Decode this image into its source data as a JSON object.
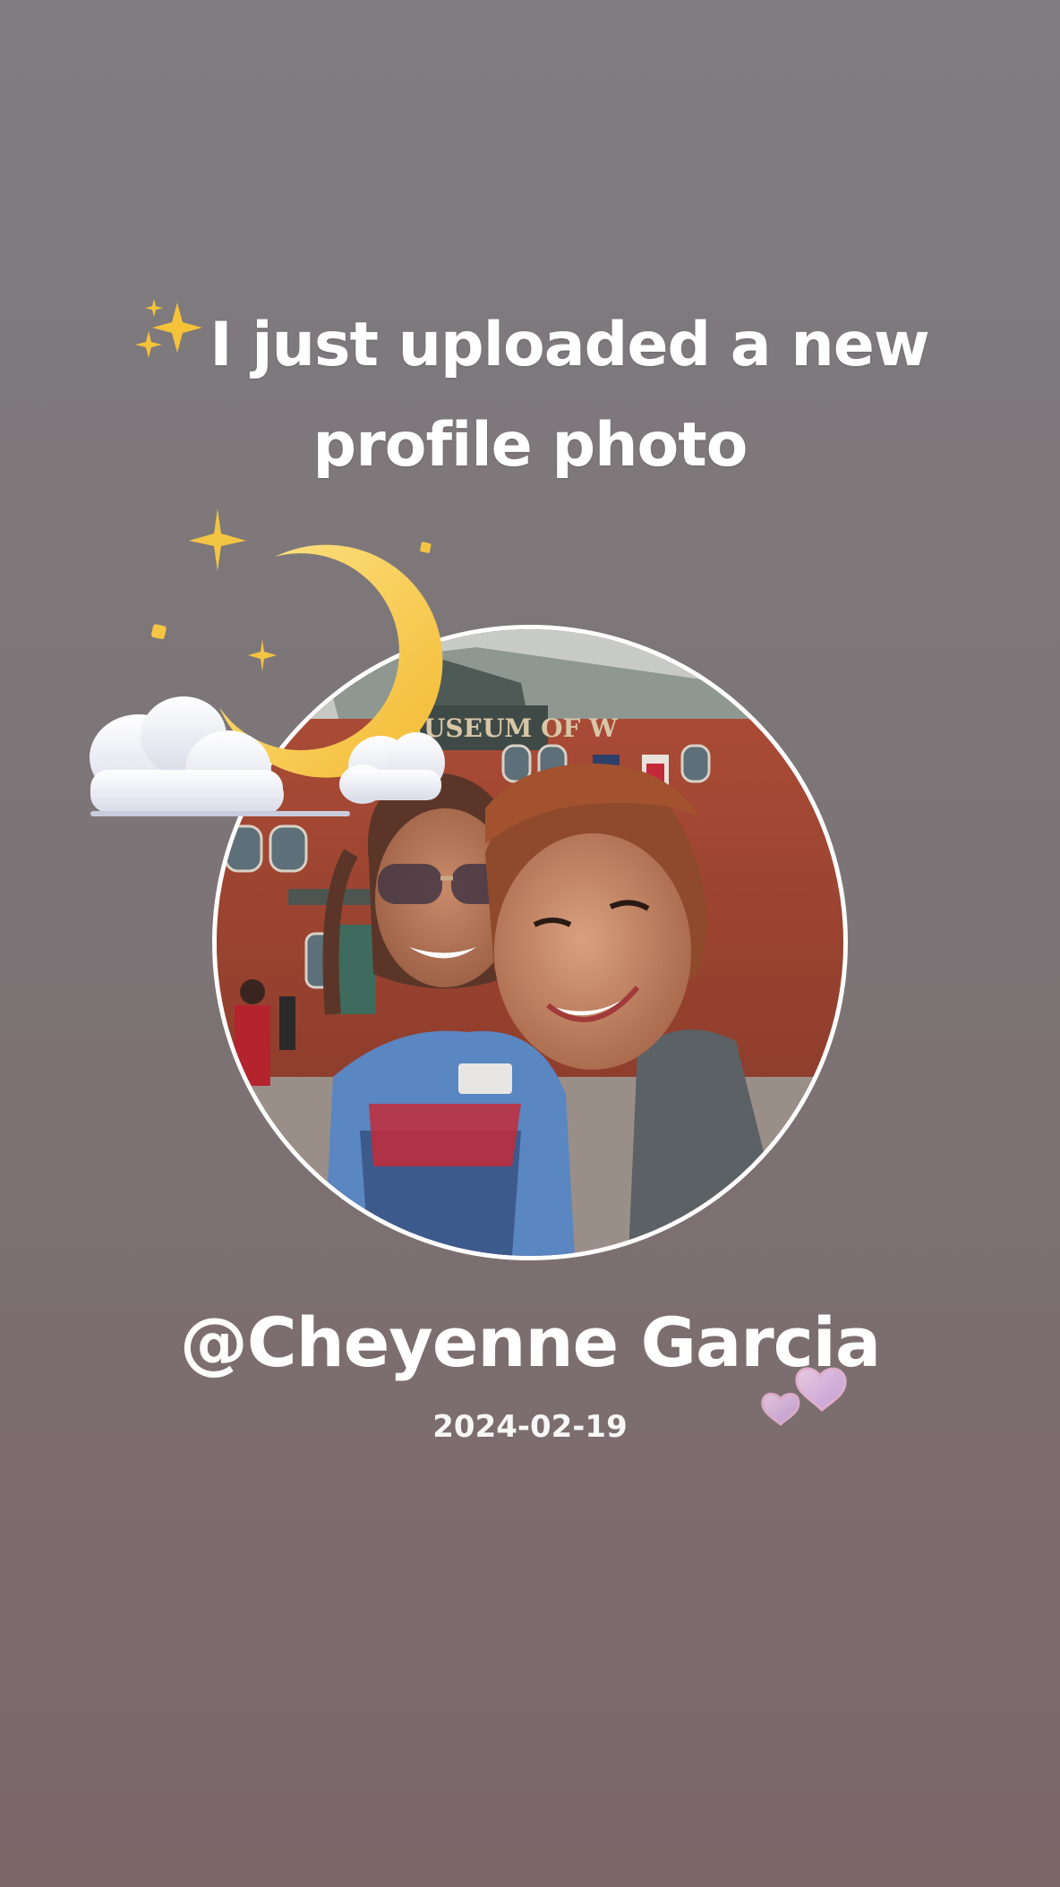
{
  "story": {
    "headline": "I just uploaded a new profile photo",
    "username": "@Cheyenne Garcia",
    "date": "2024-02-19",
    "sign_text": "MUSEUM OF W"
  },
  "icons": {
    "headline_icon": "sparkles-icon",
    "decor_top": "moon-clouds-stars-icon",
    "decor_bottom": "two-hearts-icon"
  },
  "colors": {
    "background_top": "#807c80",
    "background_bottom": "#7b6668",
    "text": "#ffffff",
    "ring": "#ffffff",
    "moon": "#f7c948",
    "sparkle": "#f4c542"
  }
}
